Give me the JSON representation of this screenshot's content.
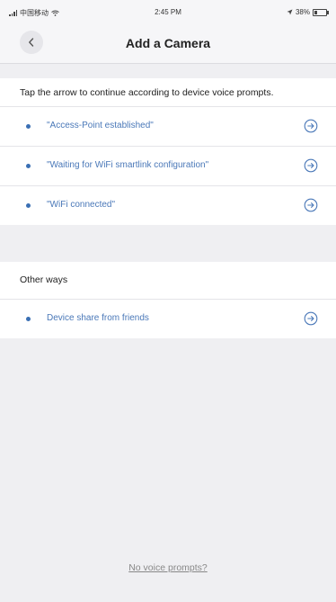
{
  "status_bar": {
    "carrier": "中国移动",
    "time": "2:45 PM",
    "battery": "38%"
  },
  "nav": {
    "title": "Add a Camera",
    "back_icon": "chevron-left-icon"
  },
  "instructions": {
    "header": "Tap the arrow to continue according to device voice prompts.",
    "items": [
      {
        "label": "\"Access-Point established\""
      },
      {
        "label": "\"Waiting for WiFi smartlink configuration\""
      },
      {
        "label": "\"WiFi connected\""
      }
    ]
  },
  "other_ways": {
    "header": "Other ways",
    "items": [
      {
        "label": "Device share from friends"
      }
    ]
  },
  "footer": {
    "link": "No voice prompts?"
  },
  "colors": {
    "accent": "#4a78b8",
    "dot": "#3a6fb4",
    "background": "#efeff2"
  }
}
